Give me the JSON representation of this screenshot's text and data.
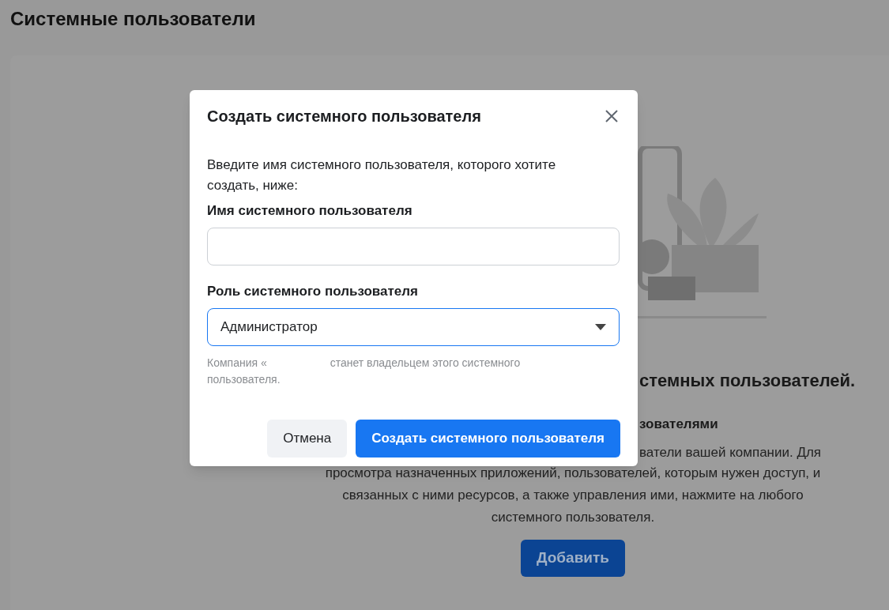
{
  "page": {
    "title": "Системные пользователи",
    "empty_state": {
      "heading": "стемных пользователей.",
      "subheading": "зователями",
      "text_line": "ватели вашей компании. Для",
      "paragraph": "просмотра назначенных приложений, пользователей, которым нужен доступ, и связанных с ними ресурсов, а также управления ими, нажмите на любого системного пользователя.",
      "add_button": "Добавить"
    }
  },
  "dialog": {
    "title": "Создать системного пользователя",
    "description": "Введите имя системного пользователя, которого хотите создать, ниже:",
    "name_field": {
      "label": "Имя системного пользователя"
    },
    "role_field": {
      "label": "Роль системного пользователя",
      "value": "Администратор",
      "focused": true
    },
    "helper_text": {
      "before": "Компания «",
      "after": "станет владельцем этого системного пользователя."
    },
    "buttons": [
      {
        "label": "Отмена",
        "kind": "secondary"
      },
      {
        "label": "Создать системного пользователя",
        "kind": "primary"
      }
    ]
  }
}
